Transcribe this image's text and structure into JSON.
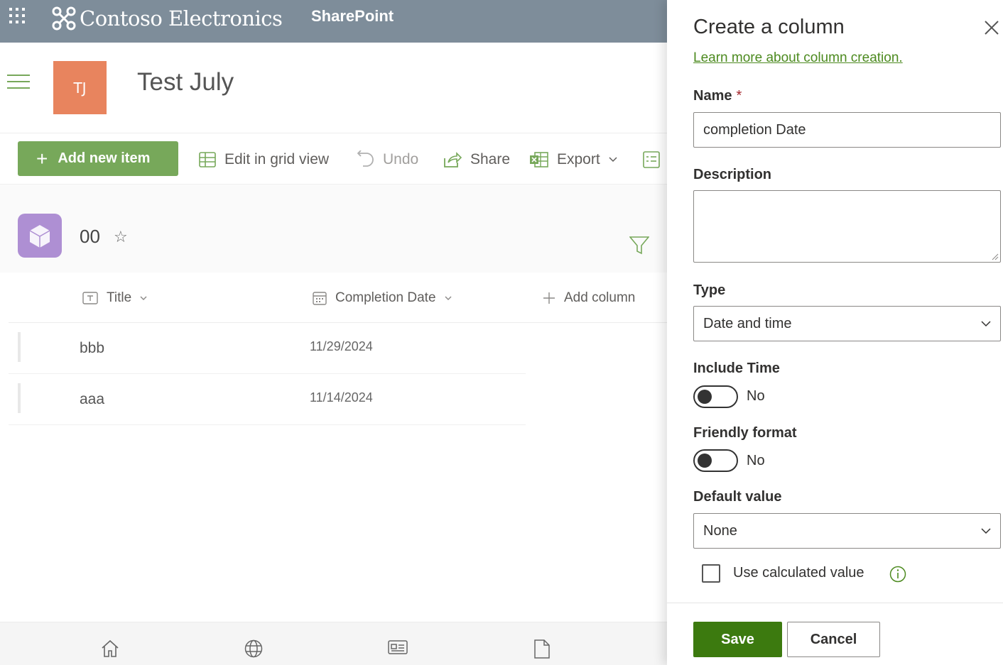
{
  "suite": {
    "brand_name": "Contoso Electronics",
    "app_name": "SharePoint",
    "waffle_icon": "app-launcher-icon",
    "brand_logo_icon": "contoso-logo-icon"
  },
  "site": {
    "logo_initials": "TJ",
    "title": "Test July",
    "logo_color": "#e8845e"
  },
  "commandbar": {
    "add_new_item": "Add new item",
    "edit_grid": "Edit in grid view",
    "undo": "Undo",
    "share": "Share",
    "export": "Export",
    "add_color": "#77a85a"
  },
  "list": {
    "title": "00",
    "icon_color": "#ae8fd3",
    "columns": [
      {
        "label": "Title"
      },
      {
        "label": "Completion Date"
      }
    ],
    "add_column_label": "Add column",
    "rows": [
      {
        "title": "bbb",
        "date": "11/29/2024"
      },
      {
        "title": "aaa",
        "date": "11/14/2024"
      }
    ]
  },
  "bottom_nav": {
    "items": [
      "home-icon",
      "globe-icon",
      "news-icon",
      "document-icon"
    ]
  },
  "panel": {
    "title": "Create a column",
    "learn_more_link": "Learn more about column creation.",
    "name_label": "Name",
    "required_marker": "*",
    "name_value": "completion Date",
    "description_label": "Description",
    "description_value": "",
    "type_label": "Type",
    "type_value": "Date and time",
    "include_time_label": "Include Time",
    "include_time_value": "No",
    "friendly_format_label": "Friendly format",
    "friendly_format_value": "No",
    "default_value_label": "Default value",
    "default_value_value": "None",
    "use_calculated_label": "Use calculated value",
    "save_label": "Save",
    "cancel_label": "Cancel",
    "accent_color": "#3c7a0f",
    "link_color": "#4c8a1f"
  }
}
